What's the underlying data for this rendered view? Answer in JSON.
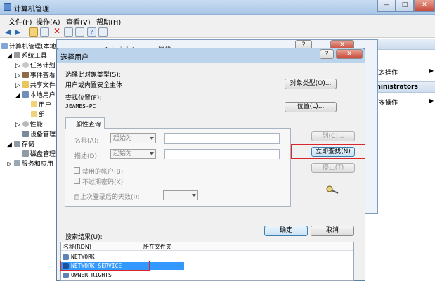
{
  "window": {
    "title": "计算机管理"
  },
  "menu": [
    "文件(F)",
    "操作(A)",
    "查看(V)",
    "帮助(H)"
  ],
  "tree": {
    "root": "计算机管理(本地)",
    "items": [
      "系统工具",
      "任务计划",
      "事件查看",
      "共享文件",
      "本地用户",
      "用户",
      "组",
      "性能",
      "设备管理",
      "存储",
      "磁盘管理",
      "服务和应用"
    ]
  },
  "properties_dialog": {
    "title": "Administrators 属性"
  },
  "actions": {
    "header": "操作",
    "items": [
      "更多操作",
      "dministrators",
      "更多操作"
    ]
  },
  "select_user": {
    "title": "选择用户",
    "object_type_label": "选择此对象类型(S):",
    "object_type_value": "用户或内置安全主体",
    "object_type_button": "对象类型(O)...",
    "location_label": "查找位置(F):",
    "location_value": "JEAMES-PC",
    "location_button": "位置(L)...",
    "tab": "一般性查询",
    "name_label": "名称(A):",
    "name_combo": "起始为",
    "desc_label": "描述(D):",
    "desc_combo": "起始为",
    "disabled_accounts": "禁用的帐户(B)",
    "no_expire": "不过期密码(X)",
    "days_label": "自上次登录后的天数(I):",
    "columns_button": "列(C)...",
    "find_now_button": "立即查找(N)",
    "stop_button": "停止(T)",
    "ok_button": "确定",
    "cancel_button": "取消",
    "results_label": "搜索结果(U):",
    "results_columns": [
      "名称(RDN)",
      "所在文件夹"
    ],
    "results_rows": [
      "NETWORK",
      "NETWORK SERVICE",
      "OWNER RIGHTS"
    ]
  }
}
